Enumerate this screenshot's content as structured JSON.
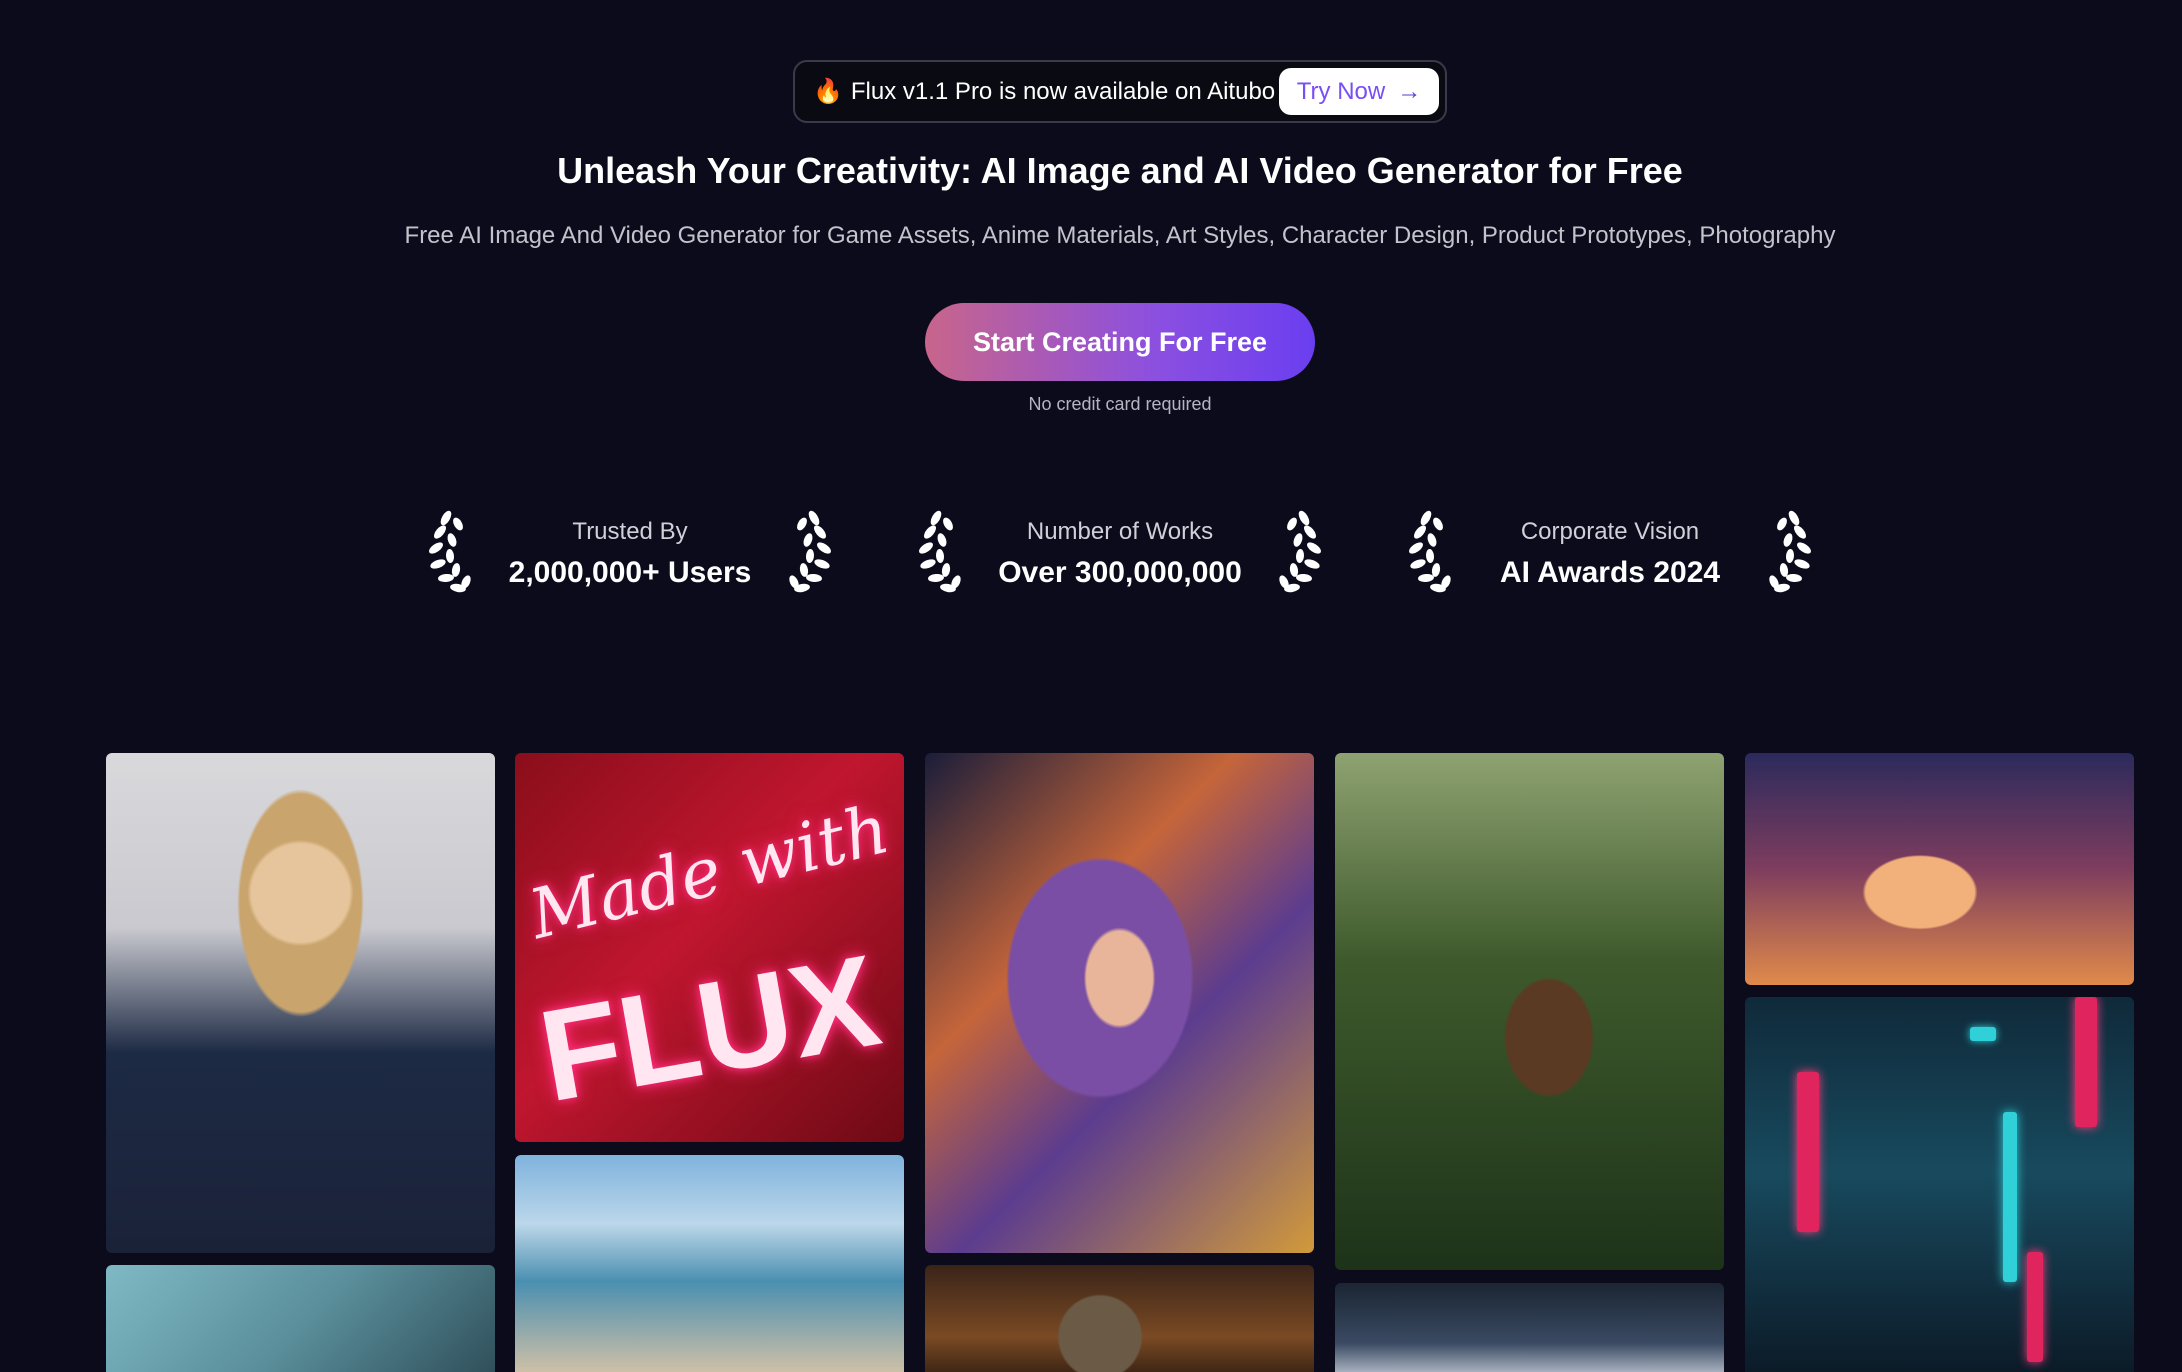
{
  "announcement": {
    "flame_icon": "fire-emoji",
    "message": "Flux v1.1 Pro is now available on Aitubo",
    "try_label": "Try Now",
    "arrow_icon": "arrow-right-icon"
  },
  "hero": {
    "headline": "Unleash Your Creativity: AI Image and AI Video Generator for Free",
    "subline": "Free AI Image And Video Generator for Game Assets, Anime Materials, Art Styles, Character Design, Product Prototypes, Photography",
    "cta_label": "Start Creating For Free",
    "cta_note": "No credit card required"
  },
  "stats": [
    {
      "label": "Trusted By",
      "value": "2,000,000+ Users"
    },
    {
      "label": "Number of Works",
      "value": "Over 300,000,000"
    },
    {
      "label": "Corporate Vision",
      "value": "AI Awards 2024"
    }
  ],
  "gallery": {
    "neon_line1": "Made with",
    "neon_line2": "FLUX"
  },
  "colors": {
    "background": "#0b0b1c",
    "accent": "#7a4ef5",
    "cta_gradient_start": "#c8658b",
    "cta_gradient_end": "#6a3ef0"
  }
}
